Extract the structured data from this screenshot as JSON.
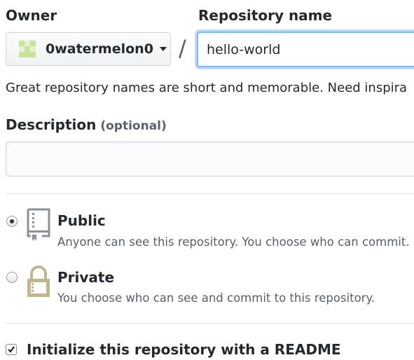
{
  "owner": {
    "label": "Owner",
    "selected": "0watermelon0"
  },
  "separator": "/",
  "repository": {
    "label": "Repository name",
    "value": "hello-world"
  },
  "hint": "Great repository names are short and memorable. Need inspira",
  "description": {
    "label": "Description",
    "optional": "(optional)",
    "value": ""
  },
  "visibility": {
    "selected": "public",
    "public": {
      "title": "Public",
      "description": "Anyone can see this repository. You choose who can commit.",
      "icon": "repo-icon"
    },
    "private": {
      "title": "Private",
      "description": "You choose who can see and commit to this repository.",
      "icon": "lock-icon"
    }
  },
  "initialize": {
    "label": "Initialize this repository with a README",
    "checked": true
  },
  "colors": {
    "focus_border": "#79b8ff",
    "avatar": "#c8e39a",
    "repo_icon": "#8a9299",
    "lock_icon": "#c2b68d"
  }
}
